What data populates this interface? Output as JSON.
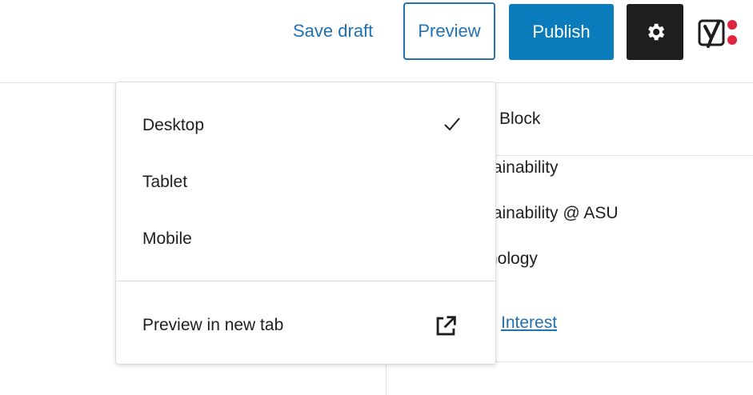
{
  "header": {
    "save_draft_label": "Save draft",
    "preview_label": "Preview",
    "publish_label": "Publish",
    "settings_icon": "gear-icon",
    "yoast_icon": "yoast-logo-icon"
  },
  "sidebar": {
    "block_label": "Block",
    "items": [
      "tainability",
      "tainability @ ASU",
      "nology"
    ],
    "link_label": "Interest"
  },
  "preview_menu": {
    "items": [
      {
        "label": "Desktop",
        "selected": true
      },
      {
        "label": "Tablet",
        "selected": false
      },
      {
        "label": "Mobile",
        "selected": false
      }
    ],
    "new_tab_label": "Preview in new tab",
    "new_tab_icon": "external-link-icon"
  },
  "colors": {
    "accent": "#2271b1",
    "publish_bg": "#0a7bbb",
    "settings_bg": "#1e1e1e",
    "yoast_dot": "#e0243b"
  }
}
